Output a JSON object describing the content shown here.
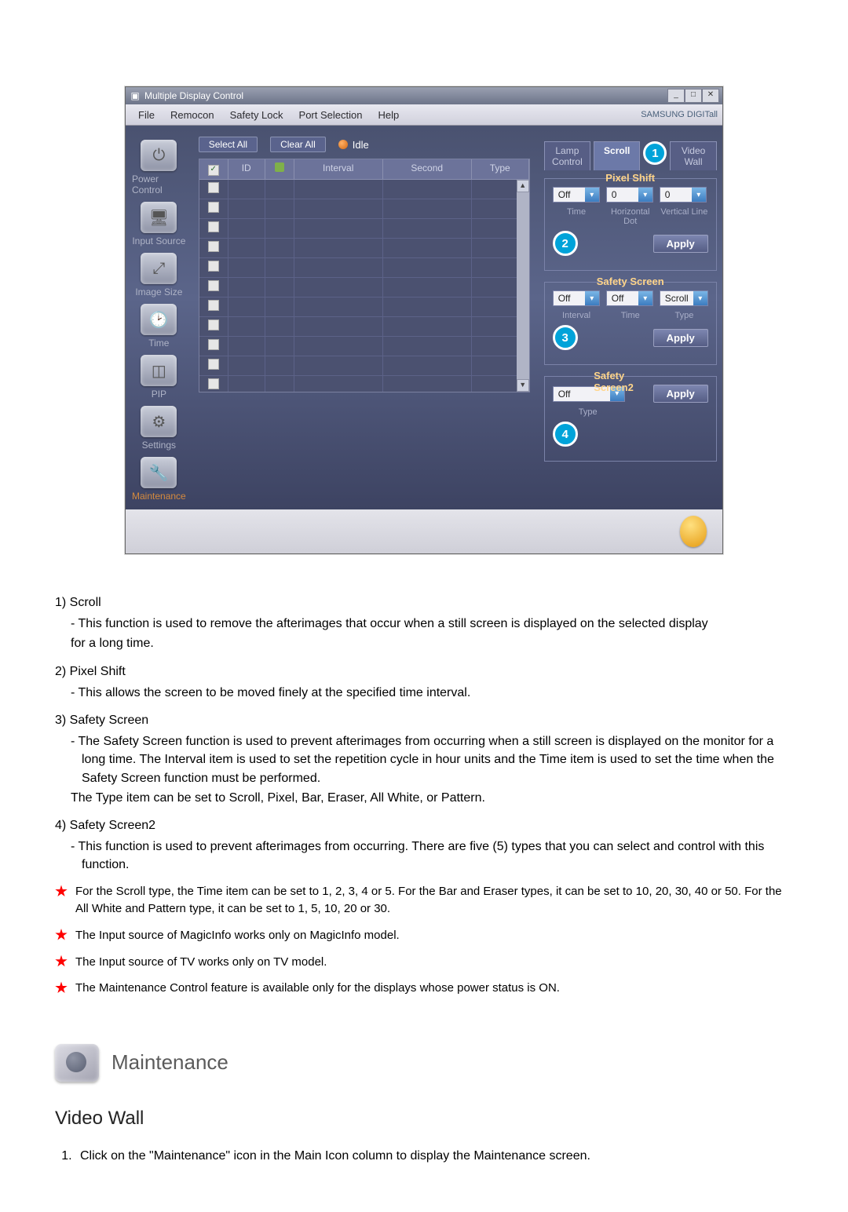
{
  "window": {
    "title": "Multiple Display Control",
    "menu": [
      "File",
      "Remocon",
      "Safety Lock",
      "Port Selection",
      "Help"
    ],
    "brand": "SAMSUNG DIGITall"
  },
  "sidebar": {
    "items": [
      {
        "label": "Power Control"
      },
      {
        "label": "Input Source"
      },
      {
        "label": "Image Size"
      },
      {
        "label": "Time"
      },
      {
        "label": "PIP"
      },
      {
        "label": "Settings"
      },
      {
        "label": "Maintenance"
      }
    ]
  },
  "toolbar": {
    "select_all": "Select All",
    "clear_all": "Clear All",
    "idle": "Idle"
  },
  "grid": {
    "headers": {
      "chk": "",
      "id": "ID",
      "grp": "",
      "interval": "Interval",
      "second": "Second",
      "type": "Type"
    },
    "row_count": 11
  },
  "right": {
    "tabs": {
      "lamp": "Lamp Control",
      "scroll": "Scroll",
      "videowall": "Video Wall"
    },
    "callouts": {
      "c1": "1",
      "c2": "2",
      "c3": "3",
      "c4": "4"
    },
    "pixel_shift": {
      "legend": "Pixel Shift",
      "v1": "Off",
      "v2": "0",
      "v3": "0",
      "labels": {
        "l1": "Time",
        "l2": "Horizontal Dot",
        "l3": "Vertical Line"
      },
      "apply": "Apply"
    },
    "safety_screen": {
      "legend": "Safety Screen",
      "v1": "Off",
      "v2": "Off",
      "v3": "Scroll",
      "labels": {
        "l1": "Interval",
        "l2": "Time",
        "l3": "Type"
      },
      "apply": "Apply"
    },
    "safety_screen2": {
      "legend": "Safety Screen2",
      "v1": "Off",
      "labels": {
        "l1": "Type"
      },
      "apply": "Apply"
    }
  },
  "doc": {
    "items": [
      {
        "title": "1)  Scroll",
        "body": "- This function is used to remove the afterimages that occur when a still screen is displayed on the selected display\nfor a long time."
      },
      {
        "title": "2)  Pixel Shift",
        "body": "- This allows the screen to be moved finely at the specified time interval."
      },
      {
        "title": "3)  Safety Screen",
        "body": "- The Safety Screen function is used to prevent afterimages from occurring when a still screen is displayed on the monitor for a long time.  The Interval item is used to set the repetition cycle in hour units and the Time item is used to set the time when the Safety Screen function must be performed.\nThe Type item can be set to Scroll, Pixel, Bar, Eraser, All White, or Pattern."
      },
      {
        "title": "4)  Safety Screen2",
        "body": "- This function is used to prevent afterimages from occurring. There are five (5) types that you can select and control with this function."
      }
    ],
    "stars": [
      "For the Scroll type, the Time item can be set to 1, 2, 3, 4 or 5. For the Bar and Eraser types, it can be set to 10, 20, 30, 40 or 50. For the All White and Pattern type, it can be set to 1, 5, 10, 20 or 30.",
      "The Input source of MagicInfo works only on MagicInfo model.",
      "The Input source of TV works only on TV model.",
      "The Maintenance Control feature is available only for the displays whose power status is ON."
    ],
    "section_title": "Maintenance",
    "subsection_title": "Video Wall",
    "steps": [
      "Click on the \"Maintenance\" icon in the Main Icon column to display the Maintenance screen."
    ]
  }
}
